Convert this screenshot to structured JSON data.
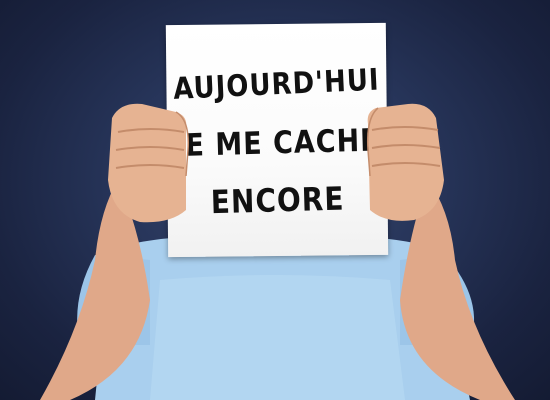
{
  "sign": {
    "lines": [
      "AUJOURD'HUI",
      "JE ME CACHE",
      "ENCORE"
    ]
  },
  "colors": {
    "background": "#1f2a4a",
    "shirt": "#a9cfee",
    "skin": "#e6b392",
    "paper": "#ffffff",
    "ink": "#111111"
  }
}
